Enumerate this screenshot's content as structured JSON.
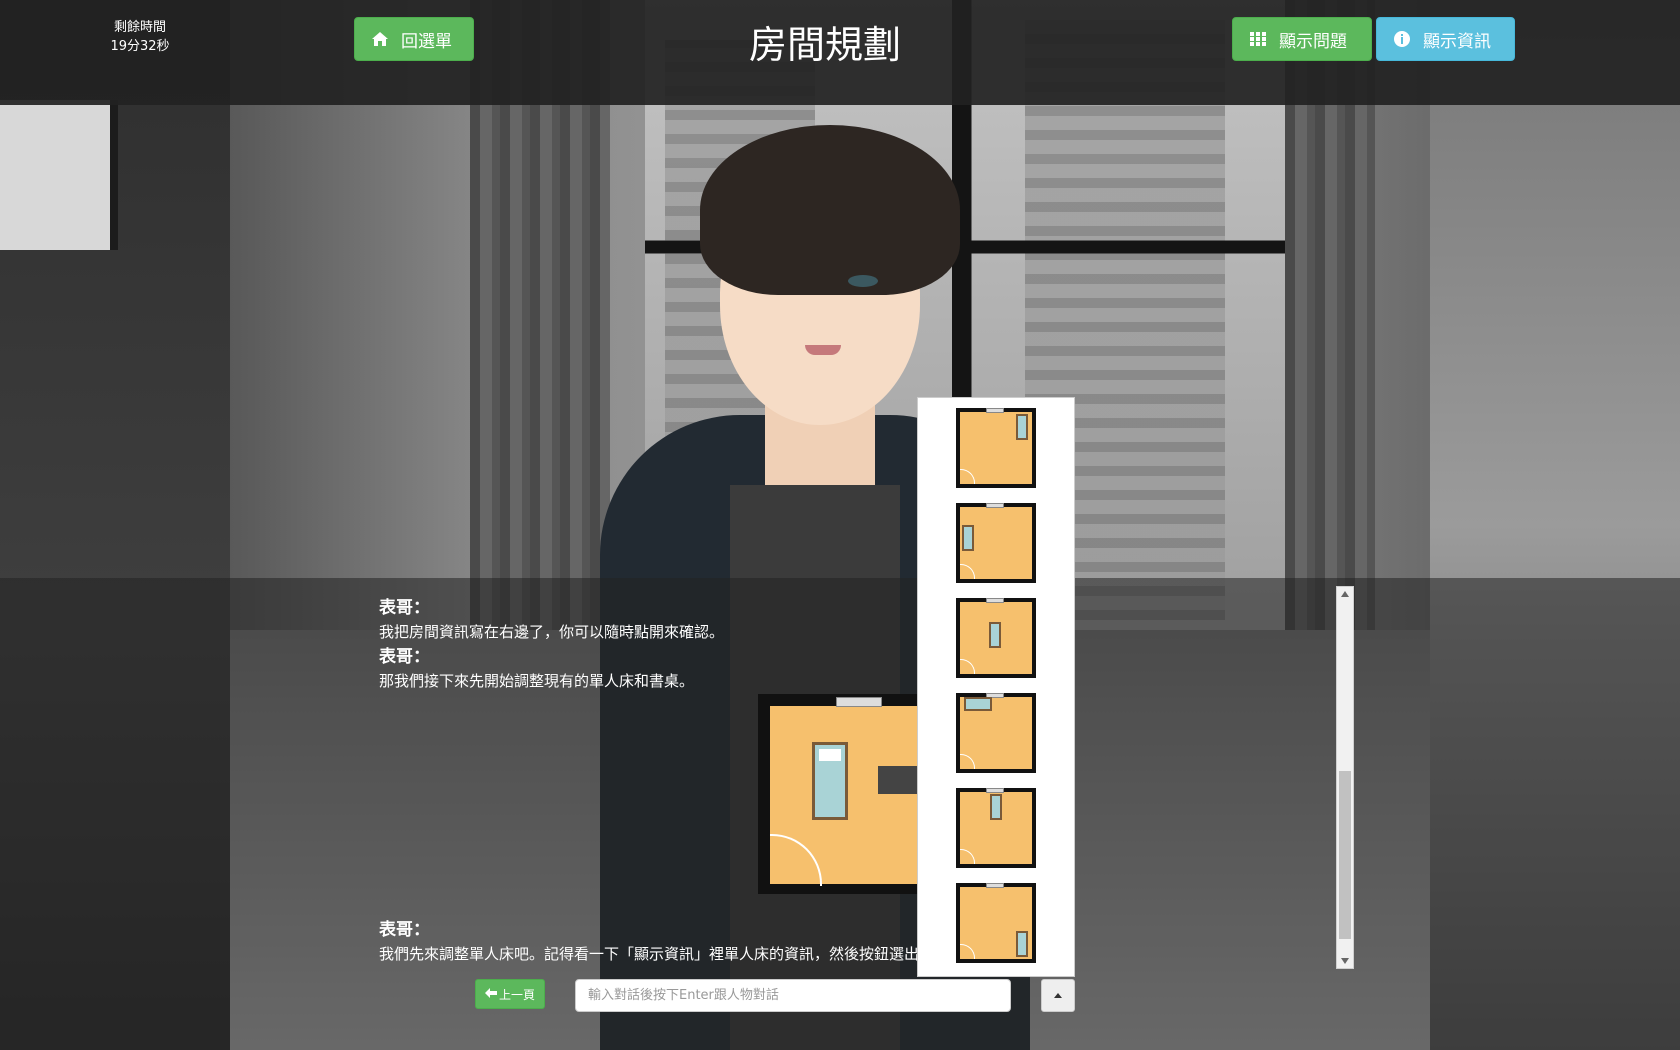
{
  "timer": {
    "label": "剩餘時間",
    "value": "19分32秒"
  },
  "header": {
    "title": "房間規劃",
    "home_button": "回選單",
    "questions_button": "顯示問題",
    "info_button": "顯示資訊"
  },
  "dialog": {
    "log": [
      {
        "speaker": "表哥：",
        "text": "我把房間資訊寫在右邊了，你可以隨時點開來確認。"
      },
      {
        "speaker": "表哥：",
        "text": "那我們接下來先開始調整現有的單人床和書桌。"
      }
    ],
    "latest": {
      "speaker": "表哥：",
      "text": "我們先來調整單人床吧。記得看一下「顯示資訊」裡單人床的資訊，然後按鈕選出你的決定吧！"
    }
  },
  "controls": {
    "prev_button": "上一頁",
    "input_placeholder": "輸入對話後按下Enter跟人物對話"
  },
  "layout_options": [
    {
      "name": "bed-top-right"
    },
    {
      "name": "bed-left-middle"
    },
    {
      "name": "bed-center"
    },
    {
      "name": "bed-top-left-horizontal"
    },
    {
      "name": "bed-top-center"
    },
    {
      "name": "bed-bottom-right"
    }
  ],
  "colors": {
    "green": "#5cb85c",
    "blue": "#5bc0de",
    "floor": "#f6c06d",
    "bed": "#a9d3d6"
  }
}
